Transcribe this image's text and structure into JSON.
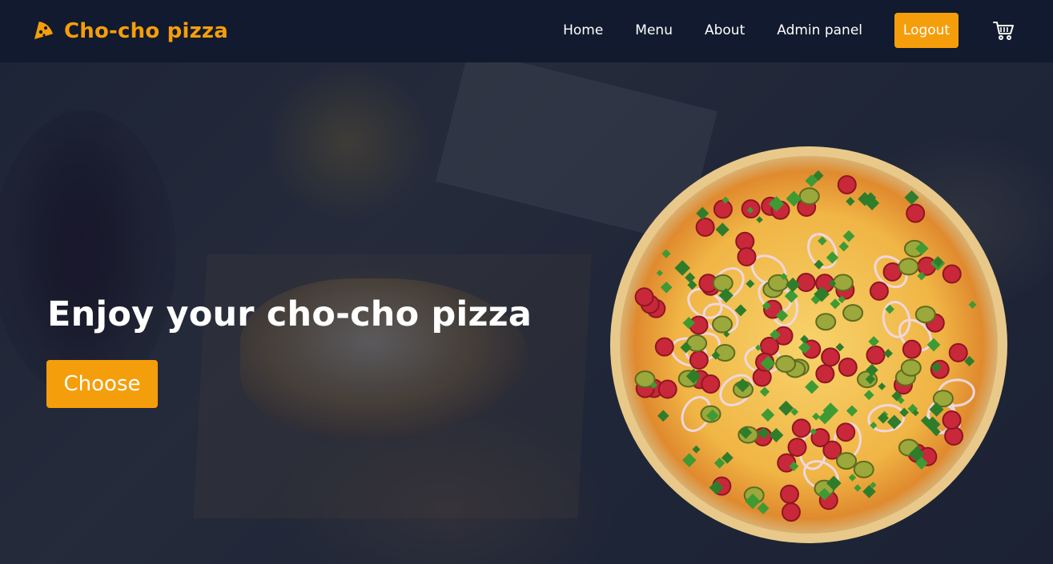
{
  "brand": {
    "name": "Cho-cho pizza",
    "icon": "pizza-slice-icon",
    "color": "#f59e0b"
  },
  "nav": {
    "links": [
      "Home",
      "Menu",
      "About",
      "Admin panel"
    ],
    "logout_label": "Logout",
    "cart_icon": "cart-icon"
  },
  "hero": {
    "title": "Enjoy your cho-cho pizza",
    "cta_label": "Choose"
  },
  "colors": {
    "navbar": "#111a2e",
    "accent": "#f59e0b",
    "text": "#ffffff"
  }
}
